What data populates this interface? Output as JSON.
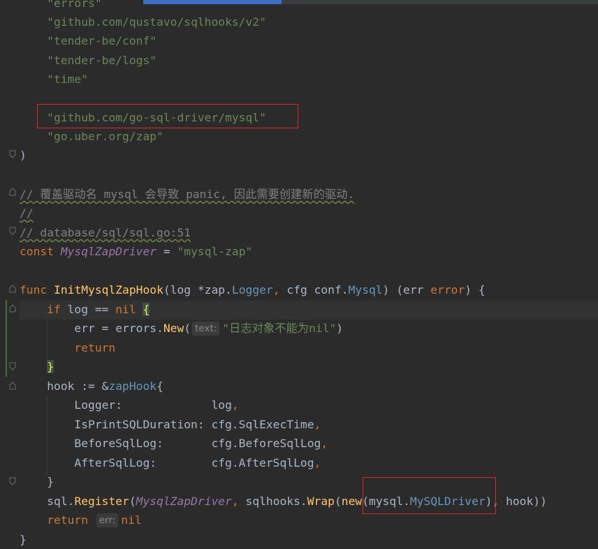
{
  "editor": {
    "language": "Go",
    "colors": {
      "background": "#2b2b2b",
      "keyword": "#cc7832",
      "string": "#6a8759",
      "function": "#ffc66d",
      "type": "#6897bb",
      "constant": "#9876aa",
      "comment": "#808080",
      "highlight_box": "#e0282a"
    },
    "lines": [
      {
        "id": "l0",
        "text": "    \"errors\""
      },
      {
        "id": "l1",
        "text": "    \"github.com/qustavo/sqlhooks/v2\""
      },
      {
        "id": "l2",
        "text": "    \"tender-be/conf\""
      },
      {
        "id": "l3",
        "text": "    \"tender-be/logs\""
      },
      {
        "id": "l4",
        "text": "    \"time\""
      },
      {
        "id": "l5",
        "text": ""
      },
      {
        "id": "l6",
        "text": "    \"github.com/go-sql-driver/mysql\""
      },
      {
        "id": "l7",
        "text": "    \"go.uber.org/zap\""
      },
      {
        "id": "l8",
        "text": ")"
      },
      {
        "id": "l9",
        "text": ""
      },
      {
        "id": "l10",
        "text": "// 覆盖驱动名 mysql 会导致 panic, 因此需要创建新的驱动."
      },
      {
        "id": "l11",
        "text": "//"
      },
      {
        "id": "l12",
        "text": "// database/sql/sql.go:51"
      },
      {
        "id": "l13",
        "text": "const MysqlZapDriver = \"mysql-zap\""
      },
      {
        "id": "l14",
        "text": ""
      },
      {
        "id": "l15",
        "text": "func InitMysqlZapHook(log *zap.Logger, cfg conf.Mysql) (err error) {"
      },
      {
        "id": "l16",
        "text": "    if log == nil {"
      },
      {
        "id": "l17",
        "text": "        err = errors.New( text: \"日志对象不能为nil\")",
        "hint": "text:"
      },
      {
        "id": "l18",
        "text": "        return"
      },
      {
        "id": "l19",
        "text": "    }"
      },
      {
        "id": "l20",
        "text": "    hook := &zapHook{"
      },
      {
        "id": "l21",
        "text": "        Logger:             log,"
      },
      {
        "id": "l22",
        "text": "        IsPrintSQLDuration: cfg.SqlExecTime,"
      },
      {
        "id": "l23",
        "text": "        BeforeSqlLog:       cfg.BeforeSqlLog,"
      },
      {
        "id": "l24",
        "text": "        AfterSqlLog:        cfg.AfterSqlLog,"
      },
      {
        "id": "l25",
        "text": "    }"
      },
      {
        "id": "l26",
        "text": "    sql.Register(MysqlZapDriver, sqlhooks.Wrap(new(mysql.MySQLDriver), hook))"
      },
      {
        "id": "l27",
        "text": "    return  err: nil",
        "hint": "err:"
      },
      {
        "id": "l28",
        "text": "}"
      }
    ],
    "tokens": {
      "imp_errors": "\"errors\"",
      "imp_sqlhooks": "\"github.com/qustavo/sqlhooks/v2\"",
      "imp_conf": "\"tender-be/conf\"",
      "imp_logs": "\"tender-be/logs\"",
      "imp_time": "\"time\"",
      "imp_mysql": "\"github.com/go-sql-driver/mysql\"",
      "imp_zap": "\"go.uber.org/zap\"",
      "close_paren": ")",
      "cmt1": "// 覆盖驱动名 mysql 会导致 panic, 因此需要创建新的驱动.",
      "cmt2": "//",
      "cmt3": "// database/sql/sql.go:51",
      "kw_const": "const",
      "const_name": "MysqlZapDriver",
      "eq": " = ",
      "const_val": "\"mysql-zap\"",
      "kw_func": "func",
      "fn_name": "InitMysqlZapHook",
      "p_open": "(log *",
      "pkg_zap": "zap.",
      "typ_logger": "Logger",
      "comma1": ", ",
      "p_cfg": "cfg ",
      "pkg_conf": "conf.",
      "typ_mysql": "Mysql",
      "p_ret": ") (err ",
      "typ_error": "error",
      "p_end": ") {",
      "kw_if": "if",
      "if_cond": " log == ",
      "kw_nil": "nil",
      "brace_open": "{",
      "err_assign": "err = ",
      "pkg_errors": "errors.",
      "fn_new": "New",
      "paren_open": "(",
      "hint_text": "text:",
      "err_msg": "\"日志对象不能为nil\"",
      "paren_close": ")",
      "kw_return": "return",
      "brace_close": "}",
      "hook_decl": "hook := &",
      "typ_zaphook": "zapHook",
      "lbrace": "{",
      "f_logger": "Logger:             log",
      "f_isprint": "IsPrintSQLDuration: cfg.SqlExecTime",
      "f_before": "BeforeSqlLog:       cfg.BeforeSqlLog",
      "f_after": "AfterSqlLog:        cfg.AfterSqlLog",
      "comma": ",",
      "sql_pkg": "sql.",
      "fn_register": "Register",
      "reg_arg": "MysqlZapDriver",
      "sqlhooks_pkg": "sqlhooks.",
      "fn_wrap": "Wrap",
      "kw_new": "new",
      "mysql_pkg": "mysql.",
      "typ_driver": "MySQLDriver",
      "tail": "), hook))",
      "hint_err": "err:",
      "end_brace": "}"
    }
  }
}
